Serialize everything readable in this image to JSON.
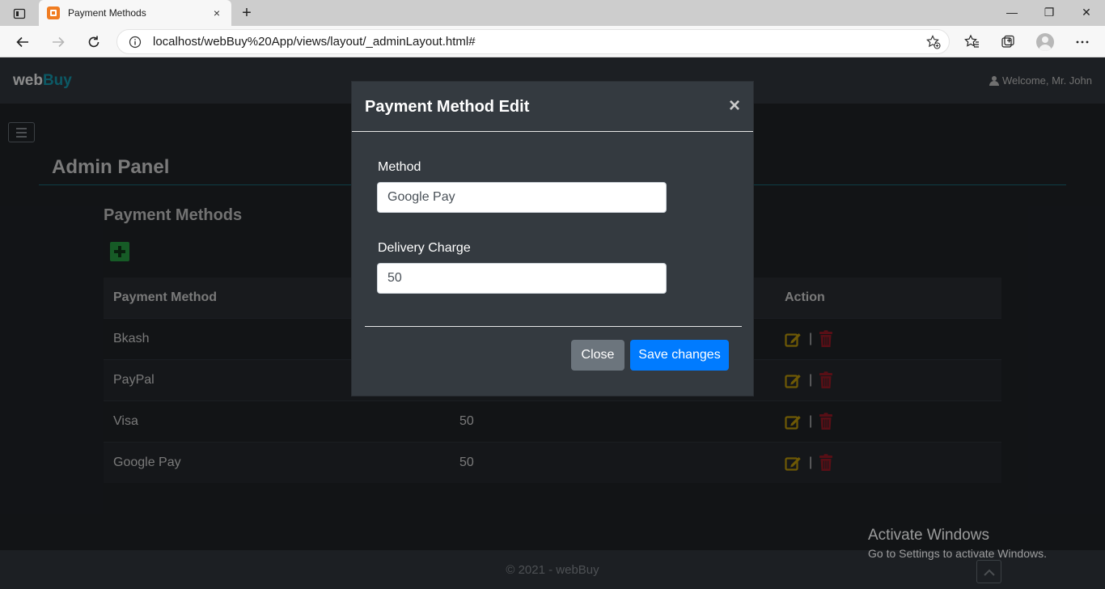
{
  "browser": {
    "tab_title": "Payment Methods",
    "tab_close": "×",
    "new_tab": "+",
    "url": "localhost/webBuy%20App/views/layout/_adminLayout.html#",
    "window_controls": {
      "minimize": "—",
      "maximize": "❐",
      "close": "✕"
    }
  },
  "navbar": {
    "brand_web": "web",
    "brand_buy": "Buy",
    "welcome": "Welcome, Mr. John"
  },
  "page": {
    "admin_title": "Admin Panel",
    "section_title": "Payment Methods"
  },
  "table": {
    "headers": [
      "Payment Method",
      "",
      "Action"
    ],
    "rows": [
      {
        "method": "Bkash",
        "charge": ""
      },
      {
        "method": "PayPal",
        "charge": ""
      },
      {
        "method": "Visa",
        "charge": "50"
      },
      {
        "method": "Google Pay",
        "charge": "50"
      }
    ],
    "separator": "|"
  },
  "modal": {
    "title": "Payment Method Edit",
    "close_x": "×",
    "method_label": "Method",
    "method_value": "Google Pay",
    "charge_label": "Delivery Charge",
    "charge_value": "50",
    "close_button": "Close",
    "save_button": "Save changes"
  },
  "footer": {
    "text": "© 2021 - webBuy"
  },
  "watermark": {
    "line1": "Activate Windows",
    "line2": "Go to Settings to activate Windows."
  },
  "colors": {
    "brand_accent": "#17a2b8",
    "add_green": "#28a745",
    "edit_yellow": "#c8a20a",
    "delete_red": "#a01c28",
    "primary_blue": "#007bff",
    "secondary_gray": "#6c757d"
  }
}
